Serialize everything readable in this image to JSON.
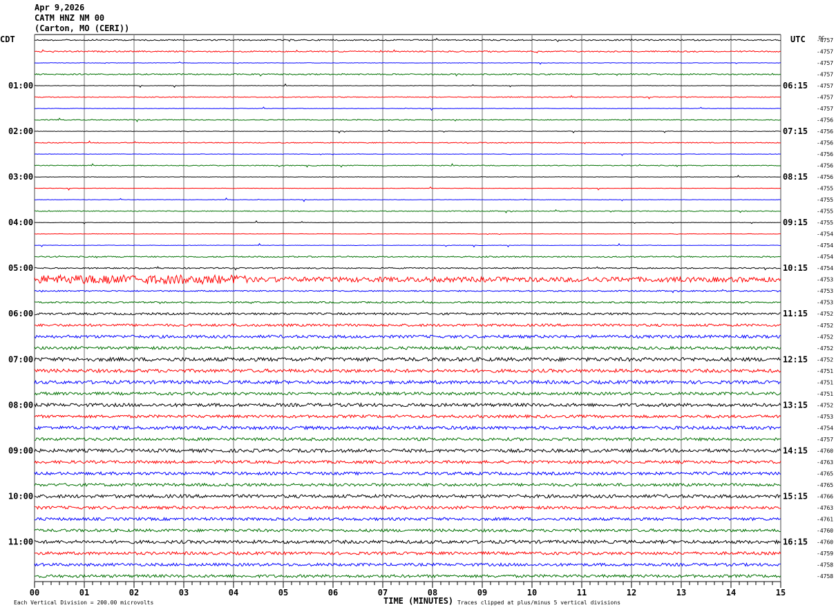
{
  "header": {
    "date": "Apr 9,2026",
    "station": "CATM HNZ NM 00",
    "location": "(Carton, MO (CERI))"
  },
  "chart_data": {
    "type": "line",
    "title": "CATM HNZ NM 00 helicorder",
    "xlabel": "TIME (MINUTES)",
    "x_ticks": [
      "00",
      "01",
      "02",
      "03",
      "04",
      "05",
      "06",
      "07",
      "08",
      "09",
      "10",
      "11",
      "12",
      "13",
      "14",
      "15"
    ],
    "xlim": [
      0,
      15
    ],
    "left_axis_title": "CDT",
    "right_axis_title": "UTC",
    "dc_title": "DC",
    "left_labels": [
      "01:00",
      "02:00",
      "03:00",
      "04:00",
      "05:00",
      "06:00",
      "07:00",
      "08:00",
      "09:00",
      "10:00",
      "11:00"
    ],
    "right_labels": [
      "06:15",
      "07:15",
      "08:15",
      "09:15",
      "10:15",
      "11:15",
      "12:15",
      "13:15",
      "14:15",
      "15:15",
      "16:15"
    ],
    "trace_colors": [
      "#000000",
      "#ff0000",
      "#0000ff",
      "#007000"
    ],
    "dc_values": [
      "-4757",
      "-4757",
      "-4757",
      "-4757",
      "-4757",
      "-4757",
      "-4757",
      "-4756",
      "-4756",
      "-4756",
      "-4756",
      "-4756",
      "-4756",
      "-4755",
      "-4755",
      "-4755",
      "-4755",
      "-4754",
      "-4754",
      "-4754",
      "-4754",
      "-4753",
      "-4753",
      "-4753",
      "-4752",
      "-4752",
      "-4752",
      "-4752",
      "-4752",
      "-4751",
      "-4751",
      "-4751",
      "-4752",
      "-4753",
      "-4754",
      "-4757",
      "-4760",
      "-4763",
      "-4765",
      "-4765",
      "-4766",
      "-4763",
      "-4761",
      "-4760",
      "-4760",
      "-4759",
      "-4758",
      "-4758"
    ],
    "noise_level": [
      0.3,
      0.3,
      0.1,
      0.3,
      0.1,
      0.2,
      0.1,
      0.2,
      0.1,
      0.2,
      0.1,
      0.2,
      0.1,
      0.1,
      0.1,
      0.2,
      0.1,
      0.1,
      0.1,
      0.3,
      0.3,
      1.2,
      0.3,
      0.4,
      0.5,
      0.6,
      0.7,
      0.7,
      0.9,
      0.8,
      0.8,
      0.7,
      0.8,
      0.7,
      0.8,
      0.7,
      0.8,
      0.7,
      0.7,
      0.7,
      0.8,
      0.7,
      0.7,
      0.7,
      0.8,
      0.7,
      0.7,
      0.7
    ],
    "scale_note": "Each Vertical Division =  200.00 microvolts",
    "clip_note": "Traces clipped at plus/minus 5 vertical divisions"
  }
}
